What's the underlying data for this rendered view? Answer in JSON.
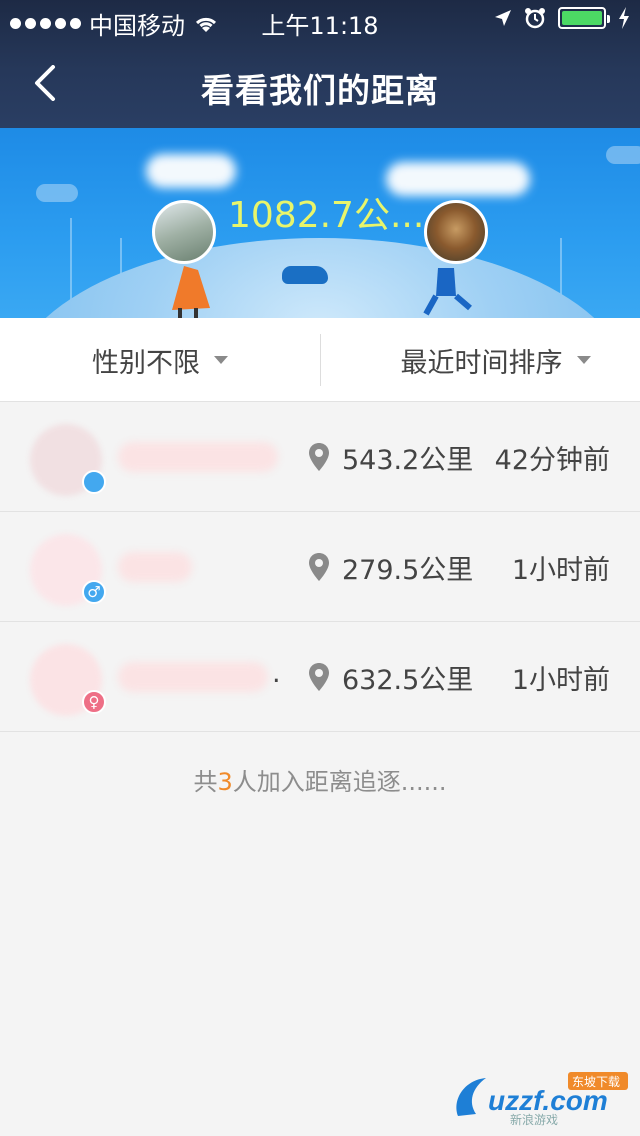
{
  "status_bar": {
    "carrier": "中国移动",
    "time": "上午11:18",
    "battery_color": "#4cd964"
  },
  "nav": {
    "title": "看看我们的距离",
    "back_icon": "chevron-left-icon"
  },
  "banner": {
    "distance": "1082.7公..."
  },
  "filters": {
    "gender": "性别不限",
    "sort": "最近时间排序"
  },
  "rows": [
    {
      "distance": "543.2公里",
      "time": "42分钟前",
      "gender_color": "#43a8ef",
      "gender_symbol": ""
    },
    {
      "distance": "279.5公里",
      "time": "1小时前",
      "gender_color": "#43a8ef",
      "gender_symbol": "♂"
    },
    {
      "distance": "632.5公里",
      "time": "1小时前",
      "gender_color": "#ee6f86",
      "gender_symbol": "♀",
      "name_tail": "."
    }
  ],
  "summary": {
    "prefix": "共",
    "count": "3",
    "suffix": "人加入距离追逐......"
  },
  "watermark": {
    "text": "uzzf.com",
    "badge": "东坡下载",
    "sub": "新浪游戏"
  }
}
